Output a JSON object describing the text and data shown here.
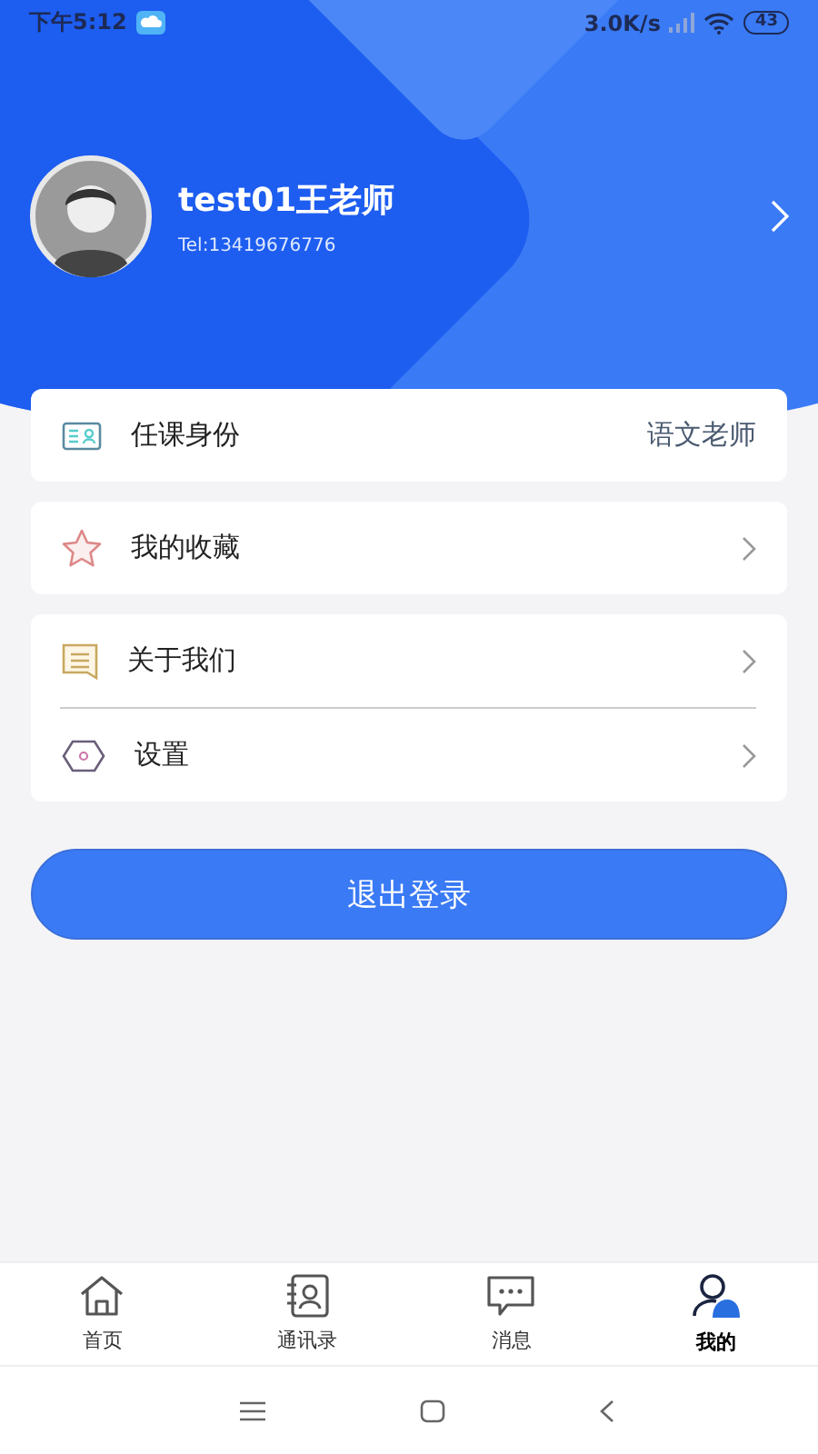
{
  "status_bar": {
    "time": "下午5:12",
    "speed": "3.0K/s",
    "battery": "43"
  },
  "profile": {
    "name": "test01王老师",
    "phone": "Tel:13419676776"
  },
  "groups": [
    {
      "items": [
        {
          "kind": "value",
          "label": "任课身份",
          "value": "语文老师"
        }
      ]
    },
    {
      "items": [
        {
          "kind": "link",
          "label": "我的收藏"
        }
      ]
    },
    {
      "items": [
        {
          "kind": "link",
          "label": "关于我们"
        },
        {
          "kind": "link",
          "label": "设置"
        }
      ]
    }
  ],
  "logout_button": "退出登录",
  "tabs": [
    {
      "label": "首页",
      "selected": false
    },
    {
      "label": "通讯录",
      "selected": false
    },
    {
      "label": "消息",
      "selected": false
    },
    {
      "label": "我的",
      "selected": true
    }
  ]
}
